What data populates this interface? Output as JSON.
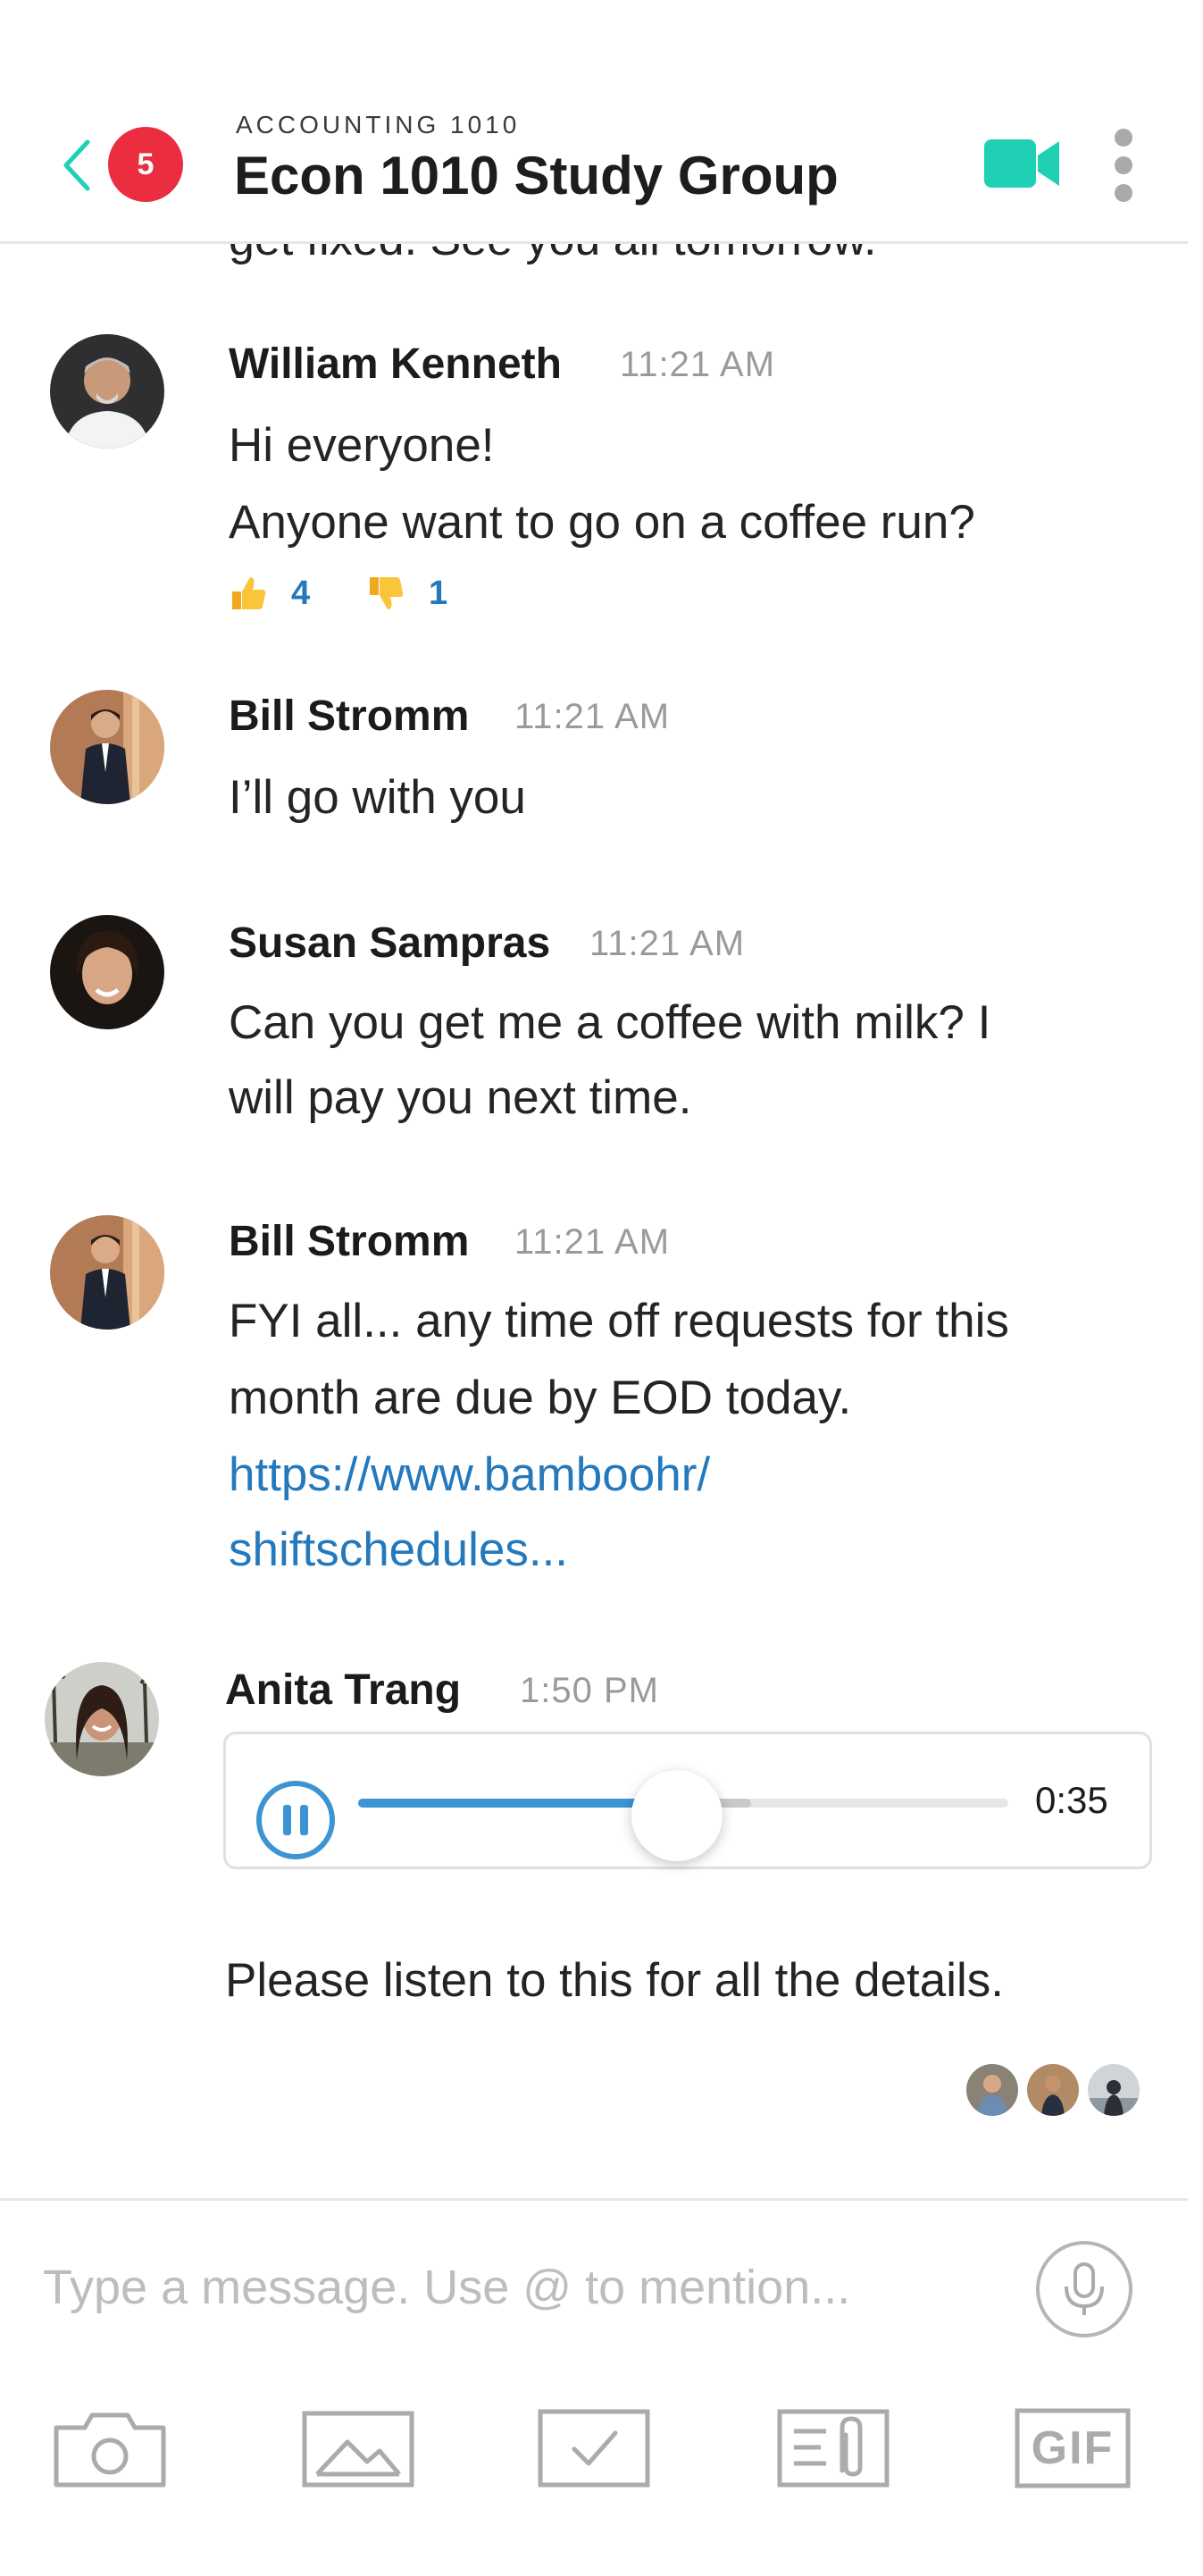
{
  "header": {
    "unread_count": "5",
    "group_subtitle": "ACCOUNTING 1010",
    "group_title": "Econ 1010 Study Group",
    "accent_color": "#1fd0b4",
    "badge_color": "#ea2d3f"
  },
  "chat": {
    "cut_off_text": "get fixed. See you all tomorrow.",
    "messages": [
      {
        "sender": "William Kenneth",
        "time": "11:21 AM",
        "lines": [
          "Hi everyone!",
          "Anyone want to go on a coffee run?"
        ],
        "reactions": [
          {
            "icon": "thumbs-up-icon",
            "count": "4"
          },
          {
            "icon": "thumbs-down-icon",
            "count": "1"
          }
        ]
      },
      {
        "sender": "Bill Stromm",
        "time": "11:21 AM",
        "lines": [
          "I’ll go with you"
        ]
      },
      {
        "sender": "Susan Sampras",
        "time": "11:21 AM",
        "lines": [
          "Can you get me a coffee with milk? I",
          "will pay you next time."
        ]
      },
      {
        "sender": "Bill Stromm",
        "time": "11:21 AM",
        "lines": [
          "FYI all... any time off requests for this",
          "month are due by EOD today."
        ],
        "link_lines": [
          "https://www.bamboohr/",
          "shiftschedules..."
        ]
      },
      {
        "sender": "Anita Trang",
        "time": "1:50 PM",
        "audio": {
          "duration": "0:35",
          "progress": 0.49
        },
        "caption": "Please listen to this for all the details."
      }
    ]
  },
  "composer": {
    "placeholder": "Type a message. Use @ to mention..."
  },
  "toolbar": {
    "items": [
      "camera-icon",
      "image-icon",
      "checkbox-icon",
      "attachment-icon",
      "gif-icon"
    ],
    "gif_label": "GIF"
  }
}
